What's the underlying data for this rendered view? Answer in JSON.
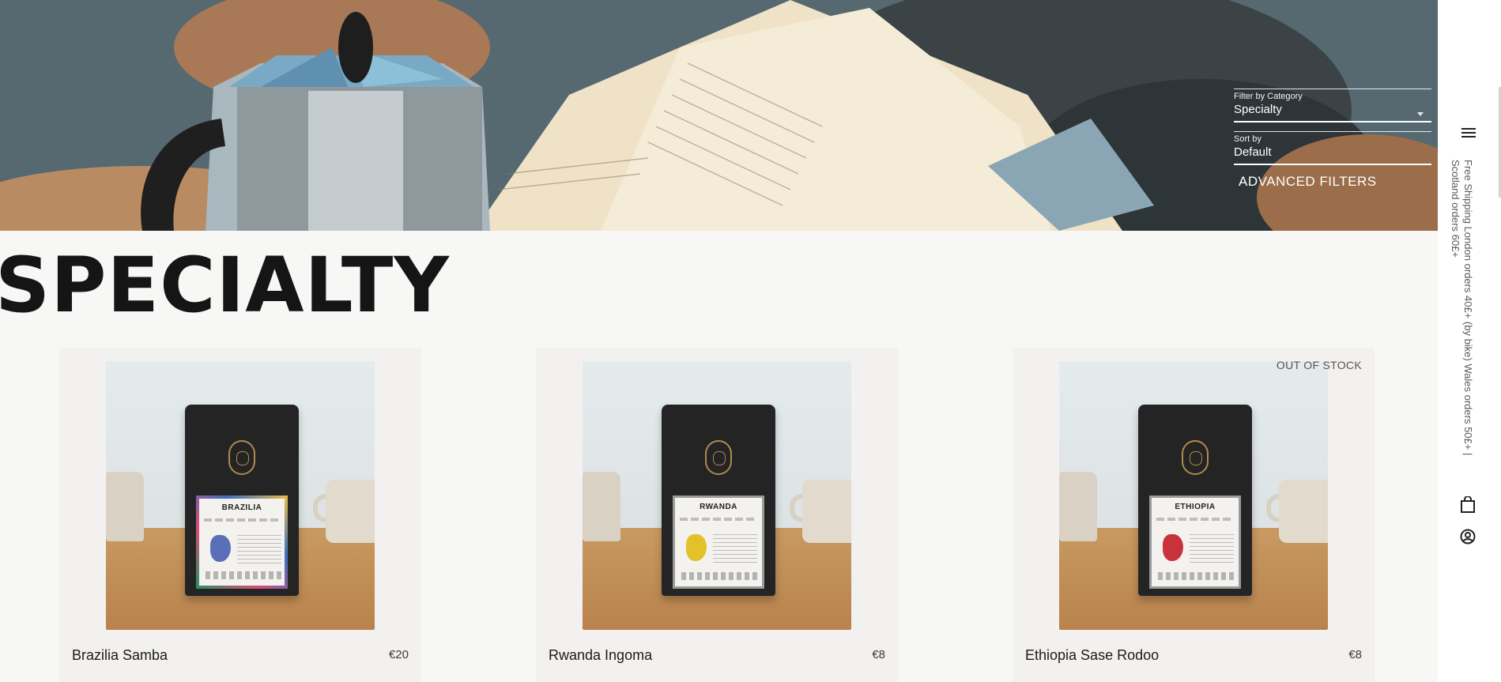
{
  "filters": {
    "category_label": "Filter by Category",
    "category_value": "Specialty",
    "sort_label": "Sort by",
    "sort_value": "Default",
    "advanced_label": "ADVANCED FILTERS"
  },
  "page": {
    "title": "SPECIALTY"
  },
  "sidebar": {
    "shipping_text": "Free Shipping  London orders 40£+ (by bike)  Wales orders 50£+ | Scotland orders 60£+"
  },
  "products": [
    {
      "name": "Brazilia Samba",
      "price": "€20",
      "bag_label": "BRAZILIA",
      "map_color": "#5a6fb8",
      "stock": ""
    },
    {
      "name": "Rwanda Ingoma",
      "price": "€8",
      "bag_label": "RWANDA",
      "map_color": "#e2c12a",
      "stock": ""
    },
    {
      "name": "Ethiopia Sase Rodoo",
      "price": "€8",
      "bag_label": "ETHIOPIA",
      "map_color": "#c8323a",
      "stock": "OUT OF STOCK"
    }
  ],
  "colors": {
    "background": "#f7f7f6",
    "card": "#f2f1ef",
    "text": "#1a1a1a"
  }
}
